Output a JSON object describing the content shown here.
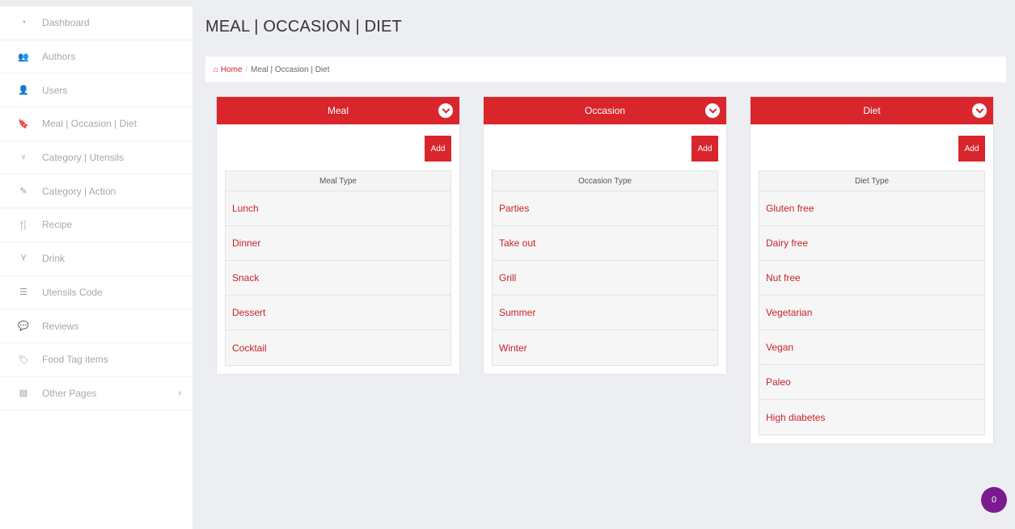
{
  "sidebar": {
    "items": [
      {
        "label": "Dashboard",
        "icon": "dashboard-icon",
        "glyph": "◔"
      },
      {
        "label": "Authors",
        "icon": "authors-icon",
        "glyph": "👥"
      },
      {
        "label": "Users",
        "icon": "user-icon",
        "glyph": "👤"
      },
      {
        "label": "Meal | Occasion | Diet",
        "icon": "bookmark-icon",
        "glyph": "🔖"
      },
      {
        "label": "Category | Utensils",
        "icon": "utensils-icon",
        "glyph": "♆"
      },
      {
        "label": "Category | Action",
        "icon": "edit-icon",
        "glyph": "✎"
      },
      {
        "label": "Recipe",
        "icon": "cutlery-icon",
        "glyph": "🍴"
      },
      {
        "label": "Drink",
        "icon": "glass-icon",
        "glyph": "Y"
      },
      {
        "label": "Utensils Code",
        "icon": "list-icon",
        "glyph": "☰"
      },
      {
        "label": "Reviews",
        "icon": "comments-icon",
        "glyph": "💬"
      },
      {
        "label": "Food Tag items",
        "icon": "tag-icon",
        "glyph": "🏷"
      },
      {
        "label": "Other Pages",
        "icon": "pages-icon",
        "glyph": "▤",
        "chevron": "›"
      }
    ]
  },
  "page": {
    "title": "MEAL | OCCASION | DIET"
  },
  "breadcrumb": {
    "home_icon": "⌂",
    "home_label": "Home",
    "separator": "/",
    "current": "Meal | Occasion | Diet"
  },
  "panels": [
    {
      "title": "Meal",
      "add_label": "Add",
      "column": "Meal Type",
      "items": [
        "Lunch",
        "Dinner",
        "Snack",
        "Dessert",
        "Cocktail"
      ]
    },
    {
      "title": "Occasion",
      "add_label": "Add",
      "column": "Occasion Type",
      "items": [
        "Parties",
        "Take out",
        "Grill",
        "Summer",
        "Winter"
      ]
    },
    {
      "title": "Diet",
      "add_label": "Add",
      "column": "Diet Type",
      "items": [
        "Gluten free",
        "Dairy free",
        "Nut free",
        "Vegetarian",
        "Vegan",
        "Paleo",
        "High diabetes"
      ]
    }
  ],
  "badge": {
    "count": "0"
  },
  "colors": {
    "accent": "#d9262c",
    "link": "#c8232c",
    "badge": "#7a1a8e",
    "background": "#eceef1"
  }
}
